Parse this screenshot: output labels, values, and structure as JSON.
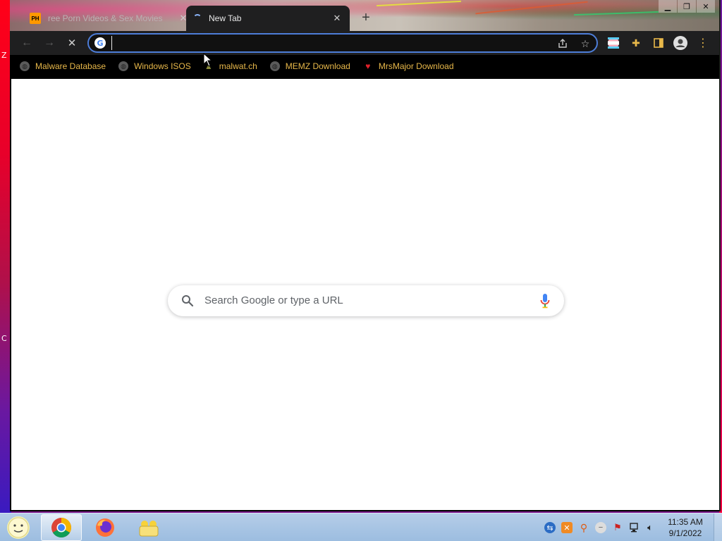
{
  "desktop": {
    "edge_labels": [
      "Z",
      "C"
    ]
  },
  "browser": {
    "tabs": [
      {
        "title": "ree Porn Videos & Sex Movies",
        "favicon": "PH",
        "active": false
      },
      {
        "title": "New Tab",
        "favicon": "loading-spinner",
        "active": true
      }
    ],
    "omnibox": {
      "value": "",
      "placeholder": ""
    },
    "bookmarks": [
      {
        "label": "Malware Database",
        "icon": "globe-icon"
      },
      {
        "label": "Windows ISOS",
        "icon": "globe-icon"
      },
      {
        "label": "malwat.ch",
        "icon": "malwatch-icon"
      },
      {
        "label": "MEMZ Download",
        "icon": "globe-icon"
      },
      {
        "label": "MrsMajor Download",
        "icon": "heart-icon"
      }
    ]
  },
  "newtab": {
    "search_placeholder": "Search Google or type a URL"
  },
  "taskbar": {
    "clock_time": "11:35 AM",
    "clock_date": "9/1/2022"
  },
  "colors": {
    "bookmark_text": "#e8b84a",
    "omnibox_border": "#4d7dd8",
    "page_bg": "#ffffff",
    "toolbar_bg": "#1f1f20"
  }
}
